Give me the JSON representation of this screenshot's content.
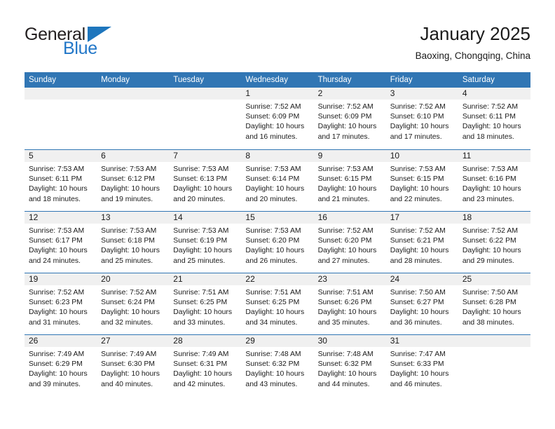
{
  "brand": {
    "name_part1": "General",
    "name_part2": "Blue"
  },
  "header": {
    "title": "January 2025",
    "location": "Baoxing, Chongqing, China"
  },
  "calendar": {
    "weekdays": [
      "Sunday",
      "Monday",
      "Tuesday",
      "Wednesday",
      "Thursday",
      "Friday",
      "Saturday"
    ],
    "accent_color": "#3176b4",
    "day_band_color": "#f0f0f0",
    "weeks": [
      [
        {
          "day": "",
          "sunrise": "",
          "sunset": "",
          "daylight_line1": "",
          "daylight_line2": ""
        },
        {
          "day": "",
          "sunrise": "",
          "sunset": "",
          "daylight_line1": "",
          "daylight_line2": ""
        },
        {
          "day": "",
          "sunrise": "",
          "sunset": "",
          "daylight_line1": "",
          "daylight_line2": ""
        },
        {
          "day": "1",
          "sunrise": "Sunrise: 7:52 AM",
          "sunset": "Sunset: 6:09 PM",
          "daylight_line1": "Daylight: 10 hours",
          "daylight_line2": "and 16 minutes."
        },
        {
          "day": "2",
          "sunrise": "Sunrise: 7:52 AM",
          "sunset": "Sunset: 6:09 PM",
          "daylight_line1": "Daylight: 10 hours",
          "daylight_line2": "and 17 minutes."
        },
        {
          "day": "3",
          "sunrise": "Sunrise: 7:52 AM",
          "sunset": "Sunset: 6:10 PM",
          "daylight_line1": "Daylight: 10 hours",
          "daylight_line2": "and 17 minutes."
        },
        {
          "day": "4",
          "sunrise": "Sunrise: 7:52 AM",
          "sunset": "Sunset: 6:11 PM",
          "daylight_line1": "Daylight: 10 hours",
          "daylight_line2": "and 18 minutes."
        }
      ],
      [
        {
          "day": "5",
          "sunrise": "Sunrise: 7:53 AM",
          "sunset": "Sunset: 6:11 PM",
          "daylight_line1": "Daylight: 10 hours",
          "daylight_line2": "and 18 minutes."
        },
        {
          "day": "6",
          "sunrise": "Sunrise: 7:53 AM",
          "sunset": "Sunset: 6:12 PM",
          "daylight_line1": "Daylight: 10 hours",
          "daylight_line2": "and 19 minutes."
        },
        {
          "day": "7",
          "sunrise": "Sunrise: 7:53 AM",
          "sunset": "Sunset: 6:13 PM",
          "daylight_line1": "Daylight: 10 hours",
          "daylight_line2": "and 20 minutes."
        },
        {
          "day": "8",
          "sunrise": "Sunrise: 7:53 AM",
          "sunset": "Sunset: 6:14 PM",
          "daylight_line1": "Daylight: 10 hours",
          "daylight_line2": "and 20 minutes."
        },
        {
          "day": "9",
          "sunrise": "Sunrise: 7:53 AM",
          "sunset": "Sunset: 6:15 PM",
          "daylight_line1": "Daylight: 10 hours",
          "daylight_line2": "and 21 minutes."
        },
        {
          "day": "10",
          "sunrise": "Sunrise: 7:53 AM",
          "sunset": "Sunset: 6:15 PM",
          "daylight_line1": "Daylight: 10 hours",
          "daylight_line2": "and 22 minutes."
        },
        {
          "day": "11",
          "sunrise": "Sunrise: 7:53 AM",
          "sunset": "Sunset: 6:16 PM",
          "daylight_line1": "Daylight: 10 hours",
          "daylight_line2": "and 23 minutes."
        }
      ],
      [
        {
          "day": "12",
          "sunrise": "Sunrise: 7:53 AM",
          "sunset": "Sunset: 6:17 PM",
          "daylight_line1": "Daylight: 10 hours",
          "daylight_line2": "and 24 minutes."
        },
        {
          "day": "13",
          "sunrise": "Sunrise: 7:53 AM",
          "sunset": "Sunset: 6:18 PM",
          "daylight_line1": "Daylight: 10 hours",
          "daylight_line2": "and 25 minutes."
        },
        {
          "day": "14",
          "sunrise": "Sunrise: 7:53 AM",
          "sunset": "Sunset: 6:19 PM",
          "daylight_line1": "Daylight: 10 hours",
          "daylight_line2": "and 25 minutes."
        },
        {
          "day": "15",
          "sunrise": "Sunrise: 7:53 AM",
          "sunset": "Sunset: 6:20 PM",
          "daylight_line1": "Daylight: 10 hours",
          "daylight_line2": "and 26 minutes."
        },
        {
          "day": "16",
          "sunrise": "Sunrise: 7:52 AM",
          "sunset": "Sunset: 6:20 PM",
          "daylight_line1": "Daylight: 10 hours",
          "daylight_line2": "and 27 minutes."
        },
        {
          "day": "17",
          "sunrise": "Sunrise: 7:52 AM",
          "sunset": "Sunset: 6:21 PM",
          "daylight_line1": "Daylight: 10 hours",
          "daylight_line2": "and 28 minutes."
        },
        {
          "day": "18",
          "sunrise": "Sunrise: 7:52 AM",
          "sunset": "Sunset: 6:22 PM",
          "daylight_line1": "Daylight: 10 hours",
          "daylight_line2": "and 29 minutes."
        }
      ],
      [
        {
          "day": "19",
          "sunrise": "Sunrise: 7:52 AM",
          "sunset": "Sunset: 6:23 PM",
          "daylight_line1": "Daylight: 10 hours",
          "daylight_line2": "and 31 minutes."
        },
        {
          "day": "20",
          "sunrise": "Sunrise: 7:52 AM",
          "sunset": "Sunset: 6:24 PM",
          "daylight_line1": "Daylight: 10 hours",
          "daylight_line2": "and 32 minutes."
        },
        {
          "day": "21",
          "sunrise": "Sunrise: 7:51 AM",
          "sunset": "Sunset: 6:25 PM",
          "daylight_line1": "Daylight: 10 hours",
          "daylight_line2": "and 33 minutes."
        },
        {
          "day": "22",
          "sunrise": "Sunrise: 7:51 AM",
          "sunset": "Sunset: 6:25 PM",
          "daylight_line1": "Daylight: 10 hours",
          "daylight_line2": "and 34 minutes."
        },
        {
          "day": "23",
          "sunrise": "Sunrise: 7:51 AM",
          "sunset": "Sunset: 6:26 PM",
          "daylight_line1": "Daylight: 10 hours",
          "daylight_line2": "and 35 minutes."
        },
        {
          "day": "24",
          "sunrise": "Sunrise: 7:50 AM",
          "sunset": "Sunset: 6:27 PM",
          "daylight_line1": "Daylight: 10 hours",
          "daylight_line2": "and 36 minutes."
        },
        {
          "day": "25",
          "sunrise": "Sunrise: 7:50 AM",
          "sunset": "Sunset: 6:28 PM",
          "daylight_line1": "Daylight: 10 hours",
          "daylight_line2": "and 38 minutes."
        }
      ],
      [
        {
          "day": "26",
          "sunrise": "Sunrise: 7:49 AM",
          "sunset": "Sunset: 6:29 PM",
          "daylight_line1": "Daylight: 10 hours",
          "daylight_line2": "and 39 minutes."
        },
        {
          "day": "27",
          "sunrise": "Sunrise: 7:49 AM",
          "sunset": "Sunset: 6:30 PM",
          "daylight_line1": "Daylight: 10 hours",
          "daylight_line2": "and 40 minutes."
        },
        {
          "day": "28",
          "sunrise": "Sunrise: 7:49 AM",
          "sunset": "Sunset: 6:31 PM",
          "daylight_line1": "Daylight: 10 hours",
          "daylight_line2": "and 42 minutes."
        },
        {
          "day": "29",
          "sunrise": "Sunrise: 7:48 AM",
          "sunset": "Sunset: 6:32 PM",
          "daylight_line1": "Daylight: 10 hours",
          "daylight_line2": "and 43 minutes."
        },
        {
          "day": "30",
          "sunrise": "Sunrise: 7:48 AM",
          "sunset": "Sunset: 6:32 PM",
          "daylight_line1": "Daylight: 10 hours",
          "daylight_line2": "and 44 minutes."
        },
        {
          "day": "31",
          "sunrise": "Sunrise: 7:47 AM",
          "sunset": "Sunset: 6:33 PM",
          "daylight_line1": "Daylight: 10 hours",
          "daylight_line2": "and 46 minutes."
        },
        {
          "day": "",
          "sunrise": "",
          "sunset": "",
          "daylight_line1": "",
          "daylight_line2": ""
        }
      ]
    ]
  }
}
